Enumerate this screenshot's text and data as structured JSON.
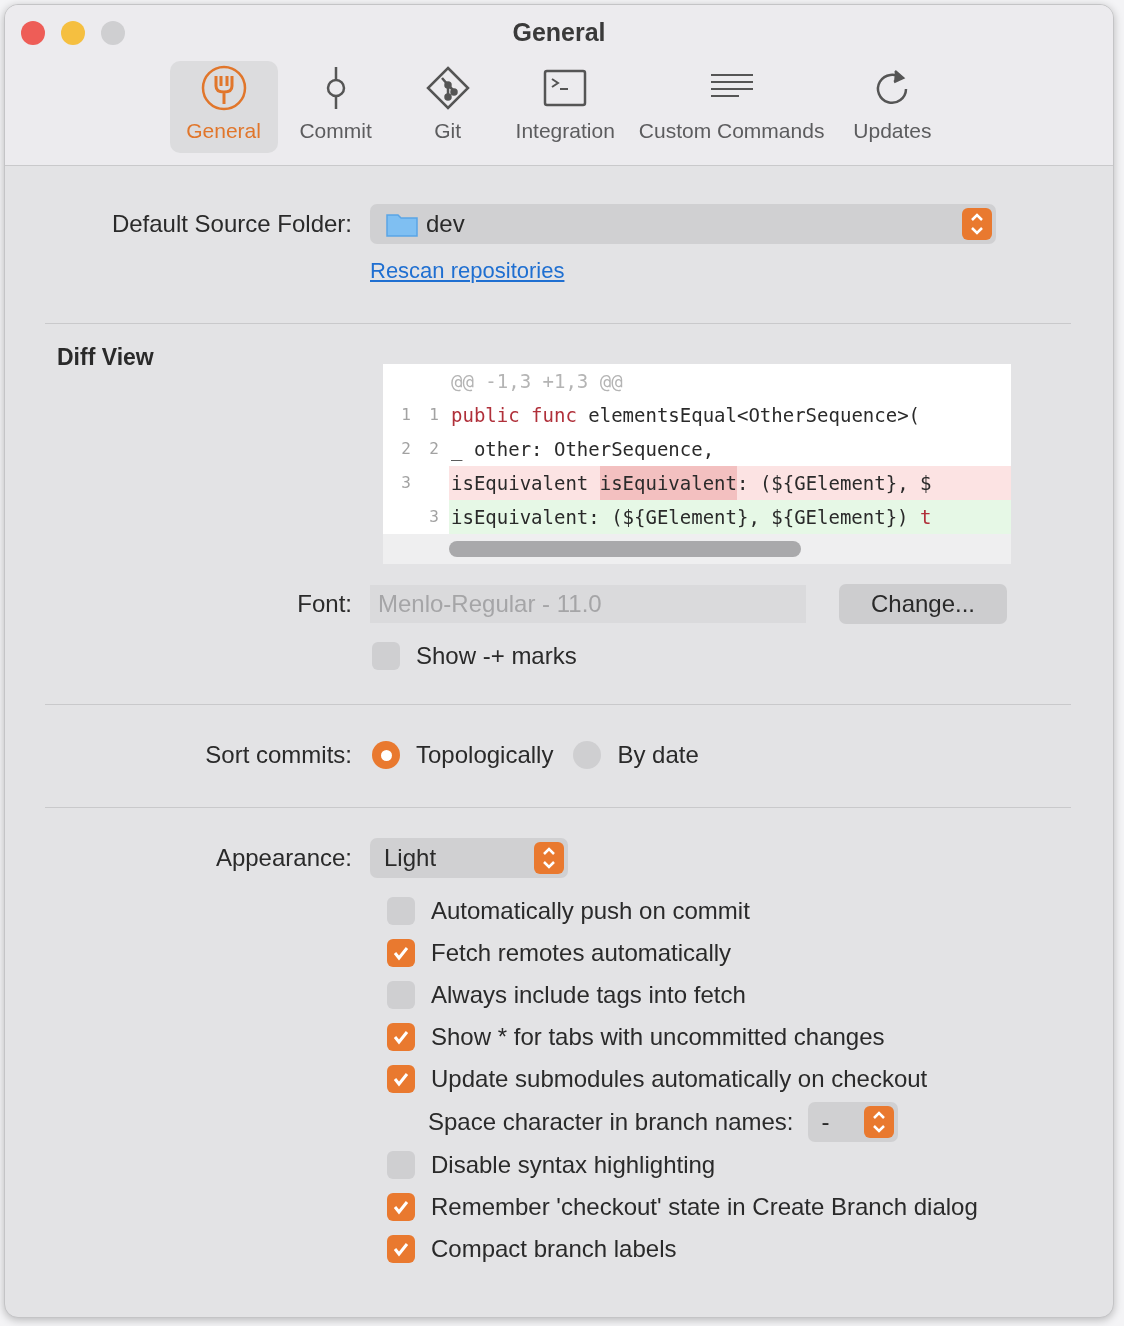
{
  "window": {
    "title": "General"
  },
  "tabs": [
    {
      "label": "General",
      "selected": true
    },
    {
      "label": "Commit",
      "selected": false
    },
    {
      "label": "Git",
      "selected": false
    },
    {
      "label": "Integration",
      "selected": false
    },
    {
      "label": "Custom Commands",
      "selected": false
    },
    {
      "label": "Updates",
      "selected": false
    }
  ],
  "source_folder": {
    "label": "Default Source Folder:",
    "value": "dev",
    "link": "Rescan repositories"
  },
  "diff_view": {
    "heading": "Diff View",
    "lines": [
      {
        "kind": "hunk",
        "segments": [
          {
            "kind": "plain",
            "text": "@@ -1,3 +1,3 @@"
          }
        ]
      },
      {
        "kind": "context",
        "old": "1",
        "new": "1",
        "segments": [
          {
            "kind": "keyword",
            "text": "public func"
          },
          {
            "kind": "plain",
            "text": " elementsEqual<OtherSequence>("
          }
        ]
      },
      {
        "kind": "context",
        "old": "2",
        "new": "2",
        "segments": [
          {
            "kind": "plain",
            "text": "_ other: OtherSequence,"
          }
        ]
      },
      {
        "kind": "removed",
        "old": "3",
        "segments": [
          {
            "kind": "plain",
            "text": "isEquivalent "
          },
          {
            "kind": "changed",
            "text": "isEquivalent"
          },
          {
            "kind": "plain",
            "text": ": (${GElement}, $"
          }
        ]
      },
      {
        "kind": "added",
        "new": "3",
        "segments": [
          {
            "kind": "plain",
            "text": "isEquivalent: (${GElement}, ${GElement}) "
          },
          {
            "kind": "keyword",
            "text": "t"
          }
        ]
      }
    ],
    "font_label": "Font:",
    "font_value": "Menlo-Regular - 11.0",
    "change_button": "Change...",
    "show_marks": {
      "label": "Show -+ marks",
      "checked": false
    }
  },
  "sort_commits": {
    "label": "Sort commits:",
    "options": [
      {
        "label": "Topologically",
        "selected": true
      },
      {
        "label": "By date",
        "selected": false
      }
    ]
  },
  "appearance": {
    "label": "Appearance:",
    "value": "Light"
  },
  "options": [
    {
      "kind": "checkbox",
      "label": "Automatically push on commit",
      "checked": false
    },
    {
      "kind": "checkbox",
      "label": "Fetch remotes automatically",
      "checked": true
    },
    {
      "kind": "checkbox",
      "label": "Always include tags into fetch",
      "checked": false
    },
    {
      "kind": "checkbox",
      "label": "Show * for tabs with uncommitted changes",
      "checked": true
    },
    {
      "kind": "checkbox",
      "label": "Update submodules automatically on checkout",
      "checked": true
    },
    {
      "kind": "select",
      "label": "Space character in branch names:",
      "popup": {
        "value": "-"
      }
    },
    {
      "kind": "checkbox",
      "label": "Disable syntax highlighting",
      "checked": false
    },
    {
      "kind": "checkbox",
      "label": "Remember 'checkout' state in Create Branch dialog",
      "checked": true
    },
    {
      "kind": "checkbox",
      "label": "Compact branch labels",
      "checked": true
    }
  ]
}
